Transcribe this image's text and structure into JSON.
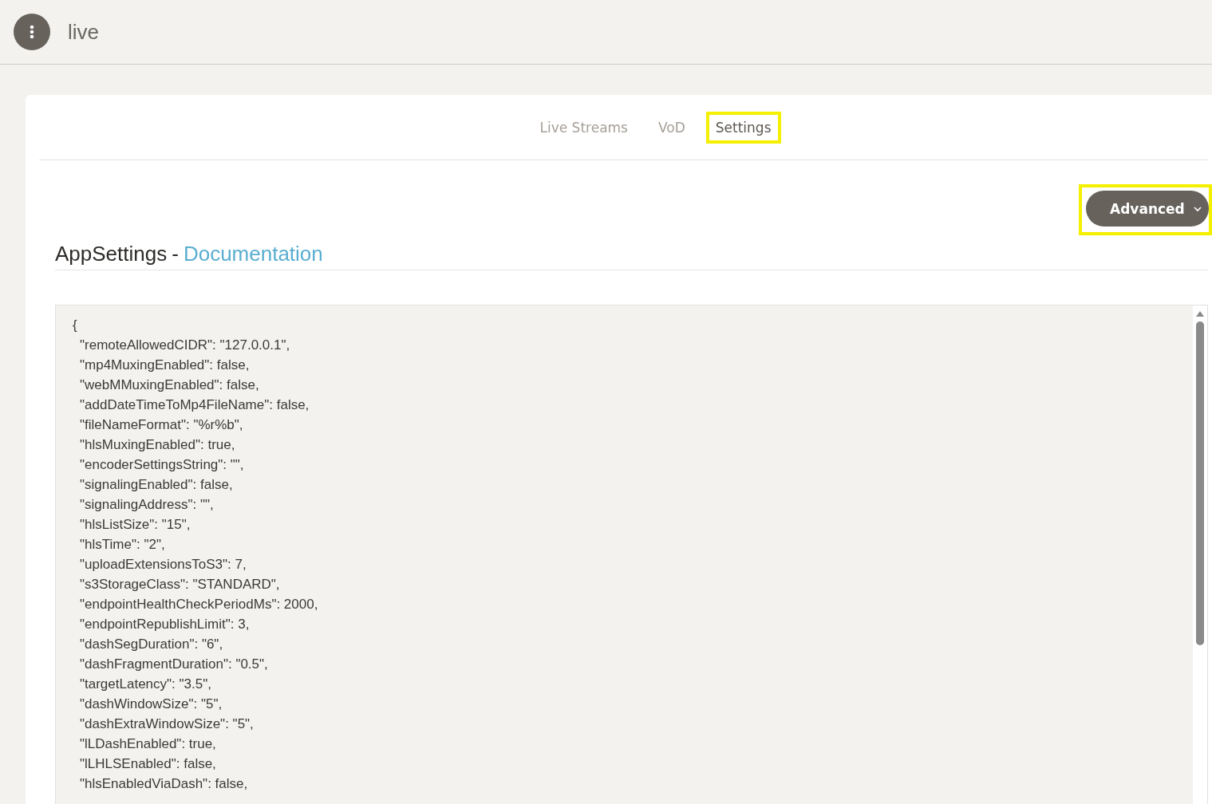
{
  "header": {
    "app_name": "live"
  },
  "tabs": [
    {
      "label": "Live Streams",
      "selected": false,
      "highlighted": false
    },
    {
      "label": "VoD",
      "selected": false,
      "highlighted": false
    },
    {
      "label": "Settings",
      "selected": true,
      "highlighted": true
    }
  ],
  "advanced_button": {
    "label": "Advanced",
    "highlighted": true
  },
  "section": {
    "title": "AppSettings",
    "separator": "-",
    "link": "Documentation"
  },
  "editor": {
    "lines": [
      "{",
      "\"remoteAllowedCIDR\": \"127.0.0.1\",",
      "\"mp4MuxingEnabled\": false,",
      "\"webMMuxingEnabled\": false,",
      "\"addDateTimeToMp4FileName\": false,",
      "\"fileNameFormat\": \"%r%b\",",
      "\"hlsMuxingEnabled\": true,",
      "\"encoderSettingsString\": \"\",",
      "\"signalingEnabled\": false,",
      "\"signalingAddress\": \"\",",
      "\"hlsListSize\": \"15\",",
      "\"hlsTime\": \"2\",",
      "\"uploadExtensionsToS3\": 7,",
      "\"s3StorageClass\": \"STANDARD\",",
      "\"endpointHealthCheckPeriodMs\": 2000,",
      "\"endpointRepublishLimit\": 3,",
      "\"dashSegDuration\": \"6\",",
      "\"dashFragmentDuration\": \"0.5\",",
      "\"targetLatency\": \"3.5\",",
      "\"dashWindowSize\": \"5\",",
      "\"dashExtraWindowSize\": \"5\",",
      "\"lLDashEnabled\": true,",
      "\"lLHLSEnabled\": false,",
      "\"hlsEnabledViaDash\": false,"
    ]
  }
}
